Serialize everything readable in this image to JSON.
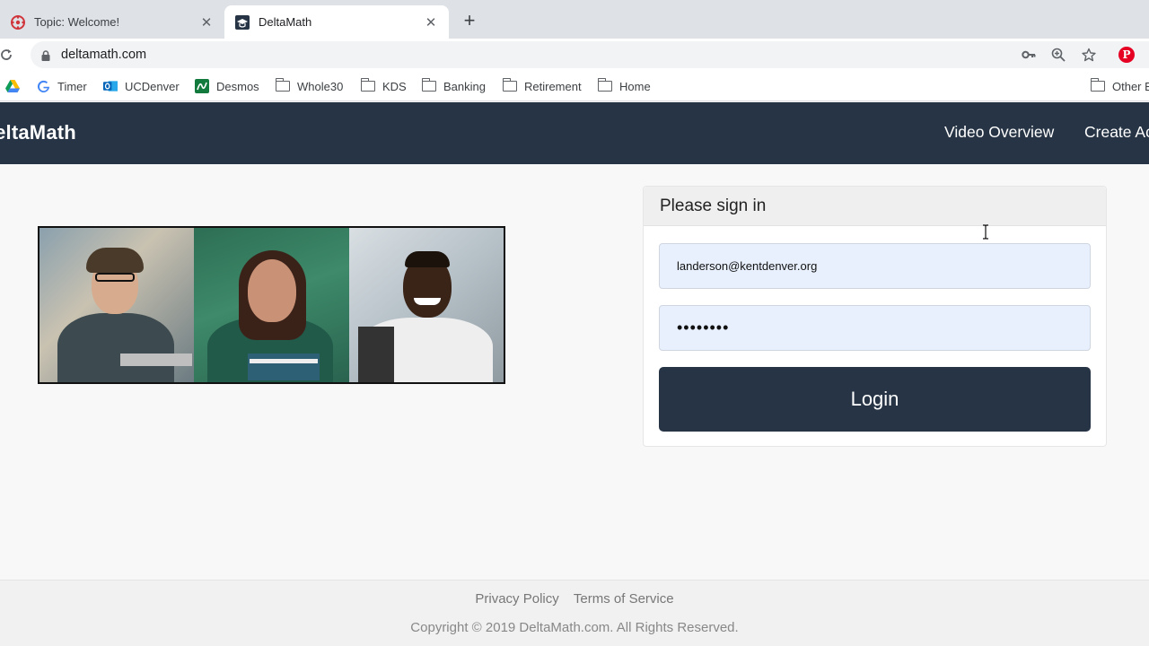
{
  "browser": {
    "tabs": [
      {
        "title": "Topic: Welcome!",
        "icon": "canvas-icon",
        "active": false
      },
      {
        "title": "DeltaMath",
        "icon": "graduation-cap-icon",
        "active": true
      }
    ],
    "new_tab": "+",
    "tab_close": "✕",
    "url": "deltamath.com",
    "bookmarks": [
      {
        "label": "",
        "icon": "google-drive-icon"
      },
      {
        "label": "Timer",
        "icon": "google-icon"
      },
      {
        "label": "UCDenver",
        "icon": "outlook-icon"
      },
      {
        "label": "Desmos",
        "icon": "desmos-icon"
      },
      {
        "label": "Whole30",
        "icon": "folder-icon"
      },
      {
        "label": "KDS",
        "icon": "folder-icon"
      },
      {
        "label": "Banking",
        "icon": "folder-icon"
      },
      {
        "label": "Retirement",
        "icon": "folder-icon"
      },
      {
        "label": "Home",
        "icon": "folder-icon"
      },
      {
        "label": "Other B",
        "icon": "folder-icon"
      }
    ]
  },
  "site": {
    "brand": "DeltaMath",
    "nav": {
      "video_overview": "Video Overview",
      "create_account": "Create Account"
    },
    "signin": {
      "heading": "Please sign in",
      "email_value": "landerson@kentdenver.org",
      "password_value": "••••••••",
      "login_label": "Login"
    },
    "footer": {
      "privacy": "Privacy Policy",
      "terms": "Terms of Service",
      "copyright": "Copyright © 2019 DeltaMath.com. All Rights Reserved."
    }
  },
  "colors": {
    "navbar": "#263445",
    "input_bg": "#e8f0fe",
    "tabstrip": "#dee1e6"
  }
}
